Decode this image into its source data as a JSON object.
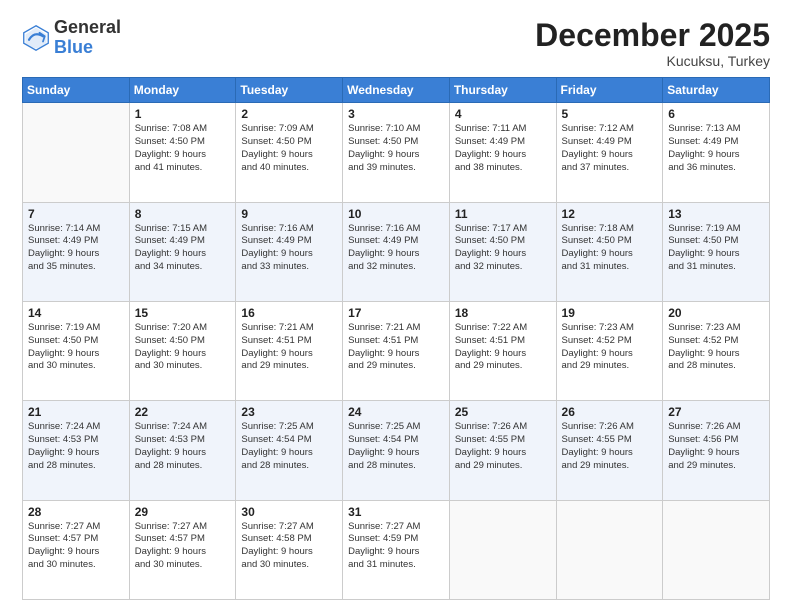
{
  "header": {
    "logo_general": "General",
    "logo_blue": "Blue",
    "month_title": "December 2025",
    "location": "Kucuksu, Turkey"
  },
  "days_of_week": [
    "Sunday",
    "Monday",
    "Tuesday",
    "Wednesday",
    "Thursday",
    "Friday",
    "Saturday"
  ],
  "weeks": [
    [
      {
        "day": null,
        "sunrise": null,
        "sunset": null,
        "daylight": null
      },
      {
        "day": "1",
        "sunrise": "Sunrise: 7:08 AM",
        "sunset": "Sunset: 4:50 PM",
        "daylight": "Daylight: 9 hours and 41 minutes."
      },
      {
        "day": "2",
        "sunrise": "Sunrise: 7:09 AM",
        "sunset": "Sunset: 4:50 PM",
        "daylight": "Daylight: 9 hours and 40 minutes."
      },
      {
        "day": "3",
        "sunrise": "Sunrise: 7:10 AM",
        "sunset": "Sunset: 4:50 PM",
        "daylight": "Daylight: 9 hours and 39 minutes."
      },
      {
        "day": "4",
        "sunrise": "Sunrise: 7:11 AM",
        "sunset": "Sunset: 4:49 PM",
        "daylight": "Daylight: 9 hours and 38 minutes."
      },
      {
        "day": "5",
        "sunrise": "Sunrise: 7:12 AM",
        "sunset": "Sunset: 4:49 PM",
        "daylight": "Daylight: 9 hours and 37 minutes."
      },
      {
        "day": "6",
        "sunrise": "Sunrise: 7:13 AM",
        "sunset": "Sunset: 4:49 PM",
        "daylight": "Daylight: 9 hours and 36 minutes."
      }
    ],
    [
      {
        "day": "7",
        "sunrise": "Sunrise: 7:14 AM",
        "sunset": "Sunset: 4:49 PM",
        "daylight": "Daylight: 9 hours and 35 minutes."
      },
      {
        "day": "8",
        "sunrise": "Sunrise: 7:15 AM",
        "sunset": "Sunset: 4:49 PM",
        "daylight": "Daylight: 9 hours and 34 minutes."
      },
      {
        "day": "9",
        "sunrise": "Sunrise: 7:16 AM",
        "sunset": "Sunset: 4:49 PM",
        "daylight": "Daylight: 9 hours and 33 minutes."
      },
      {
        "day": "10",
        "sunrise": "Sunrise: 7:16 AM",
        "sunset": "Sunset: 4:49 PM",
        "daylight": "Daylight: 9 hours and 32 minutes."
      },
      {
        "day": "11",
        "sunrise": "Sunrise: 7:17 AM",
        "sunset": "Sunset: 4:50 PM",
        "daylight": "Daylight: 9 hours and 32 minutes."
      },
      {
        "day": "12",
        "sunrise": "Sunrise: 7:18 AM",
        "sunset": "Sunset: 4:50 PM",
        "daylight": "Daylight: 9 hours and 31 minutes."
      },
      {
        "day": "13",
        "sunrise": "Sunrise: 7:19 AM",
        "sunset": "Sunset: 4:50 PM",
        "daylight": "Daylight: 9 hours and 31 minutes."
      }
    ],
    [
      {
        "day": "14",
        "sunrise": "Sunrise: 7:19 AM",
        "sunset": "Sunset: 4:50 PM",
        "daylight": "Daylight: 9 hours and 30 minutes."
      },
      {
        "day": "15",
        "sunrise": "Sunrise: 7:20 AM",
        "sunset": "Sunset: 4:50 PM",
        "daylight": "Daylight: 9 hours and 30 minutes."
      },
      {
        "day": "16",
        "sunrise": "Sunrise: 7:21 AM",
        "sunset": "Sunset: 4:51 PM",
        "daylight": "Daylight: 9 hours and 29 minutes."
      },
      {
        "day": "17",
        "sunrise": "Sunrise: 7:21 AM",
        "sunset": "Sunset: 4:51 PM",
        "daylight": "Daylight: 9 hours and 29 minutes."
      },
      {
        "day": "18",
        "sunrise": "Sunrise: 7:22 AM",
        "sunset": "Sunset: 4:51 PM",
        "daylight": "Daylight: 9 hours and 29 minutes."
      },
      {
        "day": "19",
        "sunrise": "Sunrise: 7:23 AM",
        "sunset": "Sunset: 4:52 PM",
        "daylight": "Daylight: 9 hours and 29 minutes."
      },
      {
        "day": "20",
        "sunrise": "Sunrise: 7:23 AM",
        "sunset": "Sunset: 4:52 PM",
        "daylight": "Daylight: 9 hours and 28 minutes."
      }
    ],
    [
      {
        "day": "21",
        "sunrise": "Sunrise: 7:24 AM",
        "sunset": "Sunset: 4:53 PM",
        "daylight": "Daylight: 9 hours and 28 minutes."
      },
      {
        "day": "22",
        "sunrise": "Sunrise: 7:24 AM",
        "sunset": "Sunset: 4:53 PM",
        "daylight": "Daylight: 9 hours and 28 minutes."
      },
      {
        "day": "23",
        "sunrise": "Sunrise: 7:25 AM",
        "sunset": "Sunset: 4:54 PM",
        "daylight": "Daylight: 9 hours and 28 minutes."
      },
      {
        "day": "24",
        "sunrise": "Sunrise: 7:25 AM",
        "sunset": "Sunset: 4:54 PM",
        "daylight": "Daylight: 9 hours and 28 minutes."
      },
      {
        "day": "25",
        "sunrise": "Sunrise: 7:26 AM",
        "sunset": "Sunset: 4:55 PM",
        "daylight": "Daylight: 9 hours and 29 minutes."
      },
      {
        "day": "26",
        "sunrise": "Sunrise: 7:26 AM",
        "sunset": "Sunset: 4:55 PM",
        "daylight": "Daylight: 9 hours and 29 minutes."
      },
      {
        "day": "27",
        "sunrise": "Sunrise: 7:26 AM",
        "sunset": "Sunset: 4:56 PM",
        "daylight": "Daylight: 9 hours and 29 minutes."
      }
    ],
    [
      {
        "day": "28",
        "sunrise": "Sunrise: 7:27 AM",
        "sunset": "Sunset: 4:57 PM",
        "daylight": "Daylight: 9 hours and 30 minutes."
      },
      {
        "day": "29",
        "sunrise": "Sunrise: 7:27 AM",
        "sunset": "Sunset: 4:57 PM",
        "daylight": "Daylight: 9 hours and 30 minutes."
      },
      {
        "day": "30",
        "sunrise": "Sunrise: 7:27 AM",
        "sunset": "Sunset: 4:58 PM",
        "daylight": "Daylight: 9 hours and 30 minutes."
      },
      {
        "day": "31",
        "sunrise": "Sunrise: 7:27 AM",
        "sunset": "Sunset: 4:59 PM",
        "daylight": "Daylight: 9 hours and 31 minutes."
      },
      {
        "day": null,
        "sunrise": null,
        "sunset": null,
        "daylight": null
      },
      {
        "day": null,
        "sunrise": null,
        "sunset": null,
        "daylight": null
      },
      {
        "day": null,
        "sunrise": null,
        "sunset": null,
        "daylight": null
      }
    ]
  ]
}
